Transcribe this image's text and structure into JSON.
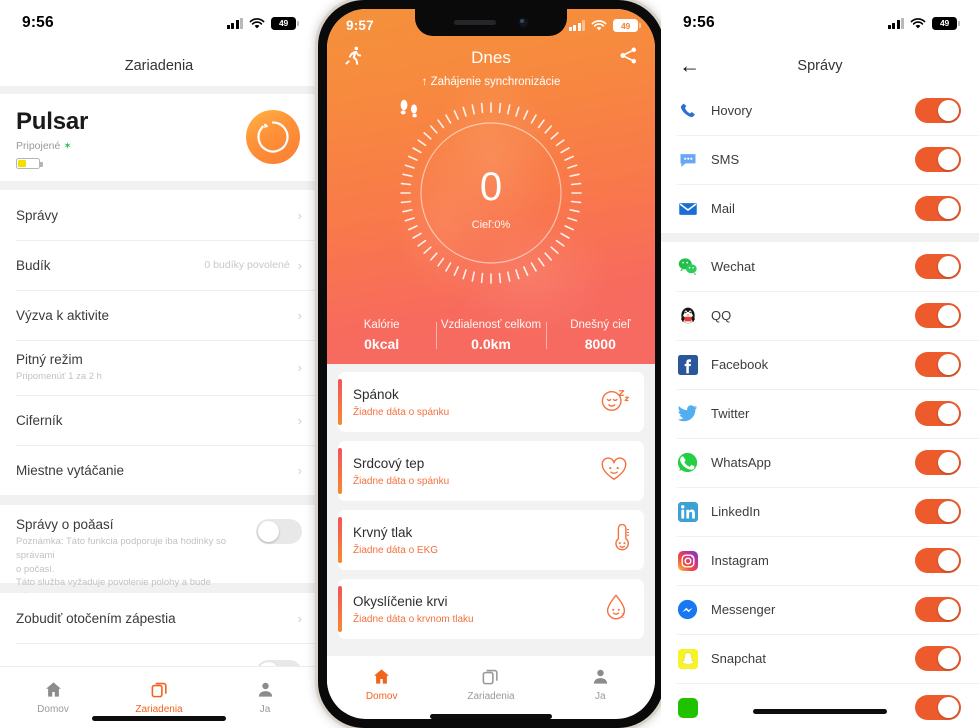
{
  "left_phone": {
    "status": {
      "time": "9:56",
      "battery": "49",
      "signal_icon": "cellular-bars-icon",
      "wifi_icon": "wifi-icon"
    },
    "navbar": {
      "title": "Zariadenia"
    },
    "device": {
      "name": "Pulsar",
      "connection": "Pripojené",
      "bluetooth_icon": "bluetooth-icon",
      "logo_icon": "pulsar-watch-logo-icon",
      "battery_icon": "device-battery-icon"
    },
    "rows": [
      {
        "label": "Správy",
        "value": "",
        "sub": ""
      },
      {
        "label": "Budík",
        "value": "0 budíky povolené",
        "sub": ""
      },
      {
        "label": "Výzva k aktivite",
        "value": "",
        "sub": ""
      },
      {
        "label": "Pitný režim",
        "value": "",
        "sub": "Pripomenúť 1 za 2 h"
      },
      {
        "label": "Ciferník",
        "value": "",
        "sub": ""
      },
      {
        "label": "Miestne vytáčanie",
        "value": "",
        "sub": ""
      }
    ],
    "weather_row": {
      "label": "Správy o poǎasí",
      "note_line1": "Poznámka: Táto funkcia podporuje iba hodinky so správami",
      "note_line2": "o počasí.",
      "note_line3": "Táto služba vyžaduje povolenie polohy a bude pristupov...",
      "toggle_state": "off"
    },
    "wrist_row": {
      "label": "Zobudiť otočením zápestia"
    },
    "tabs": [
      {
        "label": "Domov",
        "icon": "home-icon",
        "active": false
      },
      {
        "label": "Zariadenia",
        "icon": "devices-icon",
        "active": true
      },
      {
        "label": "Ja",
        "icon": "person-icon",
        "active": false
      }
    ]
  },
  "middle_phone": {
    "status": {
      "time": "9:57",
      "battery": "49",
      "signal_icon": "cellular-bars-icon",
      "wifi_icon": "wifi-icon"
    },
    "navbar": {
      "title": "Dnes",
      "left_icon": "running-man-icon",
      "right_icon": "share-icon"
    },
    "sync_text": "↑ Zahájenie synchronizácie",
    "dial": {
      "steps": "0",
      "goal_text": "Cieľ:0%",
      "feet_icon": "footsteps-icon",
      "progress_percent": 0
    },
    "stats": [
      {
        "key": "Kalórie",
        "value": "0kcal"
      },
      {
        "key": "Vzdialenosť celkom",
        "value": "0.0km"
      },
      {
        "key": "Dnešný cieľ",
        "value": "8000"
      }
    ],
    "cards": [
      {
        "title": "Spánok",
        "sub": "Žiadne dáta o spánku",
        "icon": "sleeping-face-icon"
      },
      {
        "title": "Srdcový tep",
        "sub": "Žiadne dáta o spánku",
        "icon": "heart-face-icon"
      },
      {
        "title": "Krvný tlak",
        "sub": "Žiadne dáta o EKG",
        "icon": "thermometer-face-icon"
      },
      {
        "title": "Okyslíčenie krvi",
        "sub": "Žiadne dáta o krvnom tlaku",
        "icon": "blood-drop-face-icon"
      }
    ],
    "tabs": [
      {
        "label": "Domov",
        "icon": "home-icon",
        "active": true
      },
      {
        "label": "Zariadenia",
        "icon": "devices-icon",
        "active": false
      },
      {
        "label": "Ja",
        "icon": "person-icon",
        "active": false
      }
    ]
  },
  "right_phone": {
    "status": {
      "time": "9:56",
      "battery": "49",
      "signal_icon": "cellular-bars-icon",
      "wifi_icon": "wifi-icon"
    },
    "navbar": {
      "title": "Správy",
      "back_icon": "arrow-left-icon"
    },
    "group1": [
      {
        "name": "Hovory",
        "icon": "phone-icon",
        "toggle": "on"
      },
      {
        "name": "SMS",
        "icon": "sms-icon",
        "toggle": "on"
      },
      {
        "name": "Mail",
        "icon": "mail-icon",
        "toggle": "on"
      }
    ],
    "group2": [
      {
        "name": "Wechat",
        "icon": "wechat-icon",
        "toggle": "on"
      },
      {
        "name": "QQ",
        "icon": "qq-icon",
        "toggle": "on"
      },
      {
        "name": "Facebook",
        "icon": "facebook-icon",
        "toggle": "on"
      },
      {
        "name": "Twitter",
        "icon": "twitter-icon",
        "toggle": "on"
      },
      {
        "name": "WhatsApp",
        "icon": "whatsapp-icon",
        "toggle": "on"
      },
      {
        "name": "LinkedIn",
        "icon": "linkedin-icon",
        "toggle": "on"
      },
      {
        "name": "Instagram",
        "icon": "instagram-icon",
        "toggle": "on"
      },
      {
        "name": "Messenger",
        "icon": "messenger-icon",
        "toggle": "on"
      },
      {
        "name": "Snapchat",
        "icon": "snapchat-icon",
        "toggle": "on"
      },
      {
        "name": "",
        "icon": "line-icon",
        "toggle": "on"
      }
    ]
  },
  "colors": {
    "accent_orange": "#ED5A2C",
    "tab_active": "#F2631C",
    "hero_top": "#F4913A",
    "hero_bottom": "#F66A63",
    "card_sub": "#F4703E",
    "toggle_off": "#E8E8E8"
  }
}
